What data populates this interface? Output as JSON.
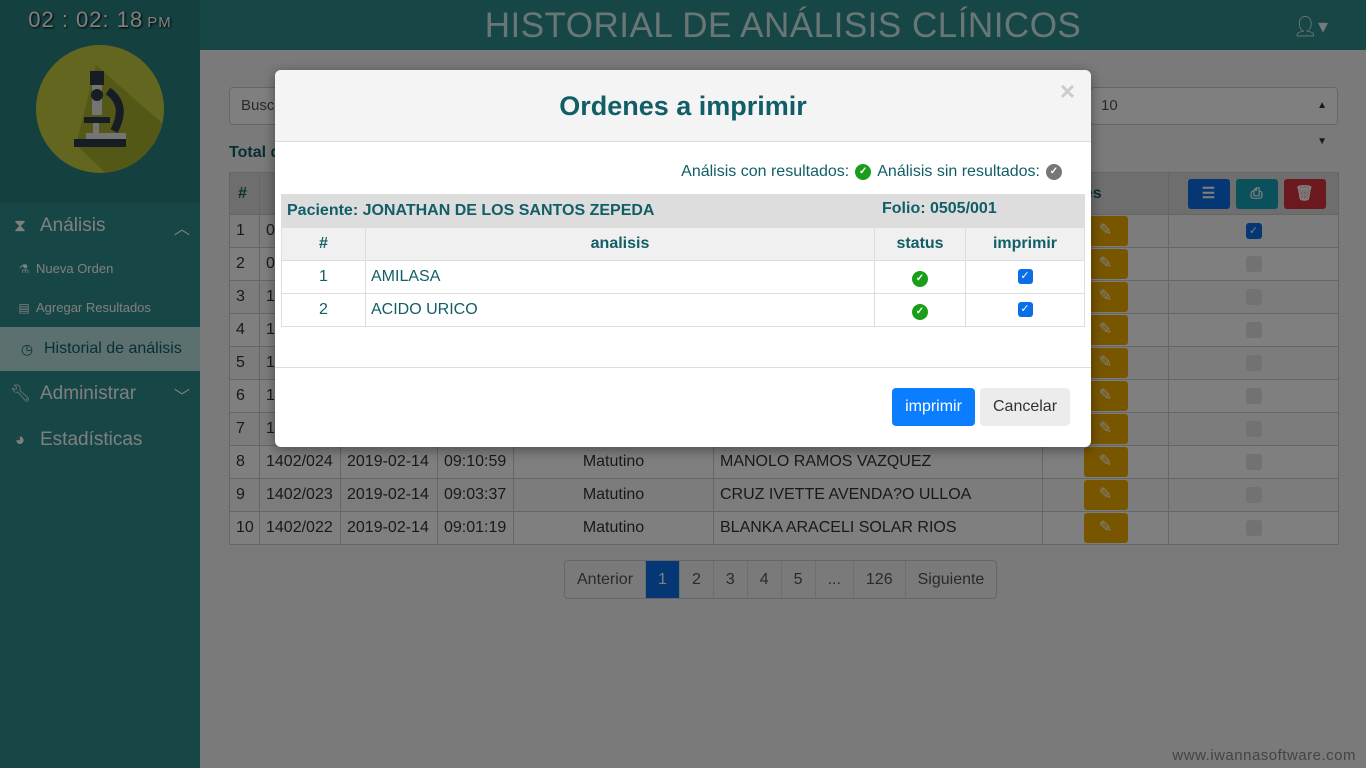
{
  "clock": {
    "time": "02 : 02: 18",
    "ampm": "PM"
  },
  "header": {
    "title": "HISTORIAL DE ANÁLISIS CLÍNICOS",
    "user_caret": "▾"
  },
  "sidebar": {
    "analisis": "Análisis",
    "nueva_orden": "Nueva Orden",
    "agregar_resultados": "Agregar Resultados",
    "historial": "Historial de análisis",
    "administrar": "Administrar",
    "estadisticas": "Estadísticas"
  },
  "main": {
    "search_placeholder": "Busc",
    "per_page": "10",
    "total_label": "Total d",
    "col_num": "#",
    "col_acciones": "ciones",
    "rows": [
      {
        "n": "1",
        "folio": "0"
      },
      {
        "n": "2",
        "folio": "0"
      },
      {
        "n": "3",
        "folio": "1"
      },
      {
        "n": "4",
        "folio": "1"
      },
      {
        "n": "5",
        "folio": "1"
      },
      {
        "n": "6",
        "folio": "1"
      },
      {
        "n": "7",
        "folio": "1"
      },
      {
        "n": "8",
        "folio": "1402/024",
        "fecha": "2019-02-14",
        "hora": "09:10:59",
        "turno": "Matutino",
        "paciente": "MANOLO RAMOS VAZQUEZ"
      },
      {
        "n": "9",
        "folio": "1402/023",
        "fecha": "2019-02-14",
        "hora": "09:03:37",
        "turno": "Matutino",
        "paciente": "CRUZ IVETTE AVENDA?O ULLOA"
      },
      {
        "n": "10",
        "folio": "1402/022",
        "fecha": "2019-02-14",
        "hora": "09:01:19",
        "turno": "Matutino",
        "paciente": "BLANKA ARACELI SOLAR RIOS"
      }
    ],
    "pager": [
      "Anterior",
      "1",
      "2",
      "3",
      "4",
      "5",
      "...",
      "126",
      "Siguiente"
    ],
    "active_page": "1"
  },
  "modal": {
    "title": "Ordenes a imprimir",
    "close": "×",
    "legend_con": "Análisis con resultados:",
    "legend_sin": "Análisis sin resultados:",
    "patient_label": "Paciente: JONATHAN DE LOS SANTOS ZEPEDA",
    "folio_label": "Folio: 0505/001",
    "col_num": "#",
    "col_analisis": "analisis",
    "col_status": "status",
    "col_imprimir": "imprimir",
    "items": [
      {
        "n": "1",
        "name": "AMILASA"
      },
      {
        "n": "2",
        "name": "ACIDO URICO"
      }
    ],
    "btn_print": "imprimir",
    "btn_cancel": "Cancelar"
  },
  "watermark": "www.iwannasoftware.com",
  "colors": {
    "teal": "#2f8c8c",
    "dark_teal": "#115e67",
    "primary": "#0a7eff",
    "warning": "#f0ad00",
    "danger": "#d9303f",
    "success": "#1a9e1a"
  }
}
